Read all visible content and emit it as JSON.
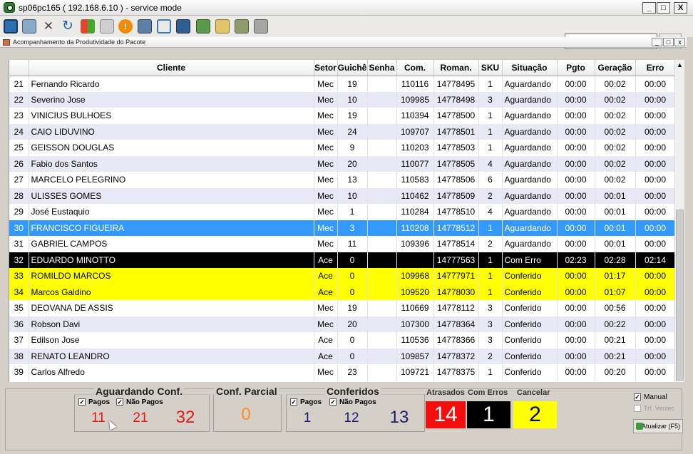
{
  "window": {
    "title": "sp06pc165 ( 192.168.6.10 ) - service mode",
    "minimize": "_",
    "maximize": "□",
    "close": "X"
  },
  "toolbar": {
    "host": "sp06pc165"
  },
  "mdi": {
    "title": "Acompanhamento da Produtividade do Pacote"
  },
  "grid": {
    "columns": [
      "",
      "Cliente",
      "Setor",
      "Guichê",
      "Senha",
      "Com.",
      "Roman.",
      "SKU",
      "Situação",
      "Pgto",
      "Geração",
      "Erro"
    ],
    "rows": [
      {
        "n": "21",
        "cliente": "Fernando Ricardo",
        "setor": "Mec",
        "guiche": "19",
        "senha": "",
        "com": "110116",
        "roman": "14778495",
        "sku": "1",
        "sit": "Aguardando",
        "pgto": "00:00",
        "ger": "00:02",
        "erro": "00:00",
        "style": "odd"
      },
      {
        "n": "22",
        "cliente": "Severino Jose",
        "setor": "Mec",
        "guiche": "10",
        "senha": "",
        "com": "109985",
        "roman": "14778498",
        "sku": "3",
        "sit": "Aguardando",
        "pgto": "00:00",
        "ger": "00:02",
        "erro": "00:00",
        "style": "even"
      },
      {
        "n": "23",
        "cliente": "VINICIUS BULHOES",
        "setor": "Mec",
        "guiche": "19",
        "senha": "",
        "com": "110394",
        "roman": "14778500",
        "sku": "1",
        "sit": "Aguardando",
        "pgto": "00:00",
        "ger": "00:02",
        "erro": "00:00",
        "style": "odd"
      },
      {
        "n": "24",
        "cliente": "CAIO LIDUVINO",
        "setor": "Mec",
        "guiche": "24",
        "senha": "",
        "com": "109707",
        "roman": "14778501",
        "sku": "1",
        "sit": "Aguardando",
        "pgto": "00:00",
        "ger": "00:02",
        "erro": "00:00",
        "style": "even"
      },
      {
        "n": "25",
        "cliente": "GEISSON DOUGLAS",
        "setor": "Mec",
        "guiche": "9",
        "senha": "",
        "com": "110203",
        "roman": "14778503",
        "sku": "1",
        "sit": "Aguardando",
        "pgto": "00:00",
        "ger": "00:02",
        "erro": "00:00",
        "style": "odd"
      },
      {
        "n": "26",
        "cliente": "Fabio dos Santos",
        "setor": "Mec",
        "guiche": "20",
        "senha": "",
        "com": "110077",
        "roman": "14778505",
        "sku": "4",
        "sit": "Aguardando",
        "pgto": "00:00",
        "ger": "00:02",
        "erro": "00:00",
        "style": "even"
      },
      {
        "n": "27",
        "cliente": "MARCELO PELEGRINO",
        "setor": "Mec",
        "guiche": "13",
        "senha": "",
        "com": "110583",
        "roman": "14778506",
        "sku": "6",
        "sit": "Aguardando",
        "pgto": "00:00",
        "ger": "00:02",
        "erro": "00:00",
        "style": "odd"
      },
      {
        "n": "28",
        "cliente": "ULISSES GOMES",
        "setor": "Mec",
        "guiche": "10",
        "senha": "",
        "com": "110462",
        "roman": "14778509",
        "sku": "2",
        "sit": "Aguardando",
        "pgto": "00:00",
        "ger": "00:01",
        "erro": "00:00",
        "style": "even"
      },
      {
        "n": "29",
        "cliente": "José Eustaquio",
        "setor": "Mec",
        "guiche": "1",
        "senha": "",
        "com": "110284",
        "roman": "14778510",
        "sku": "4",
        "sit": "Aguardando",
        "pgto": "00:00",
        "ger": "00:01",
        "erro": "00:00",
        "style": "odd"
      },
      {
        "n": "30",
        "cliente": "FRANCISCO FIGUEIRA",
        "setor": "Mec",
        "guiche": "3",
        "senha": "",
        "com": "110208",
        "roman": "14778512",
        "sku": "1",
        "sit": "Aguardando",
        "pgto": "00:00",
        "ger": "00:01",
        "erro": "00:00",
        "style": "sel"
      },
      {
        "n": "31",
        "cliente": "GABRIEL CAMPOS",
        "setor": "Mec",
        "guiche": "11",
        "senha": "",
        "com": "109396",
        "roman": "14778514",
        "sku": "2",
        "sit": "Aguardando",
        "pgto": "00:00",
        "ger": "00:01",
        "erro": "00:00",
        "style": "odd"
      },
      {
        "n": "32",
        "cliente": "EDUARDO MINOTTO",
        "setor": "Ace",
        "guiche": "0",
        "senha": "",
        "com": "",
        "roman": "14777563",
        "sku": "1",
        "sit": "Com Erro",
        "pgto": "02:23",
        "ger": "02:28",
        "erro": "02:14",
        "style": "err"
      },
      {
        "n": "33",
        "cliente": "ROMILDO MARCOS",
        "setor": "Ace",
        "guiche": "0",
        "senha": "",
        "com": "109968",
        "roman": "14777971",
        "sku": "1",
        "sit": "Conferido",
        "pgto": "00:00",
        "ger": "01:17",
        "erro": "00:00",
        "style": "yel"
      },
      {
        "n": "34",
        "cliente": "Marcos Galdino",
        "setor": "Ace",
        "guiche": "0",
        "senha": "",
        "com": "109520",
        "roman": "14778030",
        "sku": "1",
        "sit": "Conferido",
        "pgto": "00:00",
        "ger": "01:07",
        "erro": "00:00",
        "style": "yel"
      },
      {
        "n": "35",
        "cliente": "DEOVANA DE ASSIS",
        "setor": "Mec",
        "guiche": "19",
        "senha": "",
        "com": "110669",
        "roman": "14778112",
        "sku": "3",
        "sit": "Conferido",
        "pgto": "00:00",
        "ger": "00:56",
        "erro": "00:00",
        "style": "odd"
      },
      {
        "n": "36",
        "cliente": "Robson Davi",
        "setor": "Mec",
        "guiche": "20",
        "senha": "",
        "com": "107300",
        "roman": "14778364",
        "sku": "3",
        "sit": "Conferido",
        "pgto": "00:00",
        "ger": "00:22",
        "erro": "00:00",
        "style": "even"
      },
      {
        "n": "37",
        "cliente": "Edilson Jose",
        "setor": "Ace",
        "guiche": "0",
        "senha": "",
        "com": "110536",
        "roman": "14778366",
        "sku": "3",
        "sit": "Conferido",
        "pgto": "00:00",
        "ger": "00:21",
        "erro": "00:00",
        "style": "odd"
      },
      {
        "n": "38",
        "cliente": "RENATO LEANDRO",
        "setor": "Ace",
        "guiche": "0",
        "senha": "",
        "com": "109857",
        "roman": "14778372",
        "sku": "2",
        "sit": "Conferido",
        "pgto": "00:00",
        "ger": "00:21",
        "erro": "00:00",
        "style": "even"
      },
      {
        "n": "39",
        "cliente": "Carlos Alfredo",
        "setor": "Mec",
        "guiche": "23",
        "senha": "",
        "com": "109721",
        "roman": "14778375",
        "sku": "1",
        "sit": "Conferido",
        "pgto": "00:00",
        "ger": "00:20",
        "erro": "00:00",
        "style": "odd"
      }
    ]
  },
  "summary": {
    "aguardando": {
      "title": "Aguardando Conf.",
      "pagos_label": "Pagos",
      "nao_pagos_label": "Não Pagos",
      "pagos": "11",
      "nao_pagos": "21",
      "total": "32"
    },
    "parcial": {
      "title": "Conf. Parcial",
      "value": "0"
    },
    "conferidos": {
      "title": "Conferidos",
      "pagos_label": "Pagos",
      "nao_pagos_label": "Não Pagos",
      "pagos": "1",
      "nao_pagos": "12",
      "total": "13"
    },
    "atrasados": {
      "label": "Atrasados",
      "value": "14"
    },
    "com_erros": {
      "label": "Com Erros",
      "value": "1"
    },
    "cancelar": {
      "label": "Cancelar",
      "value": "2"
    },
    "manual_label": "Manual",
    "trf_ventec_label": "Trf. Ventec",
    "atualizar_label": "Atualizar (F5)"
  }
}
